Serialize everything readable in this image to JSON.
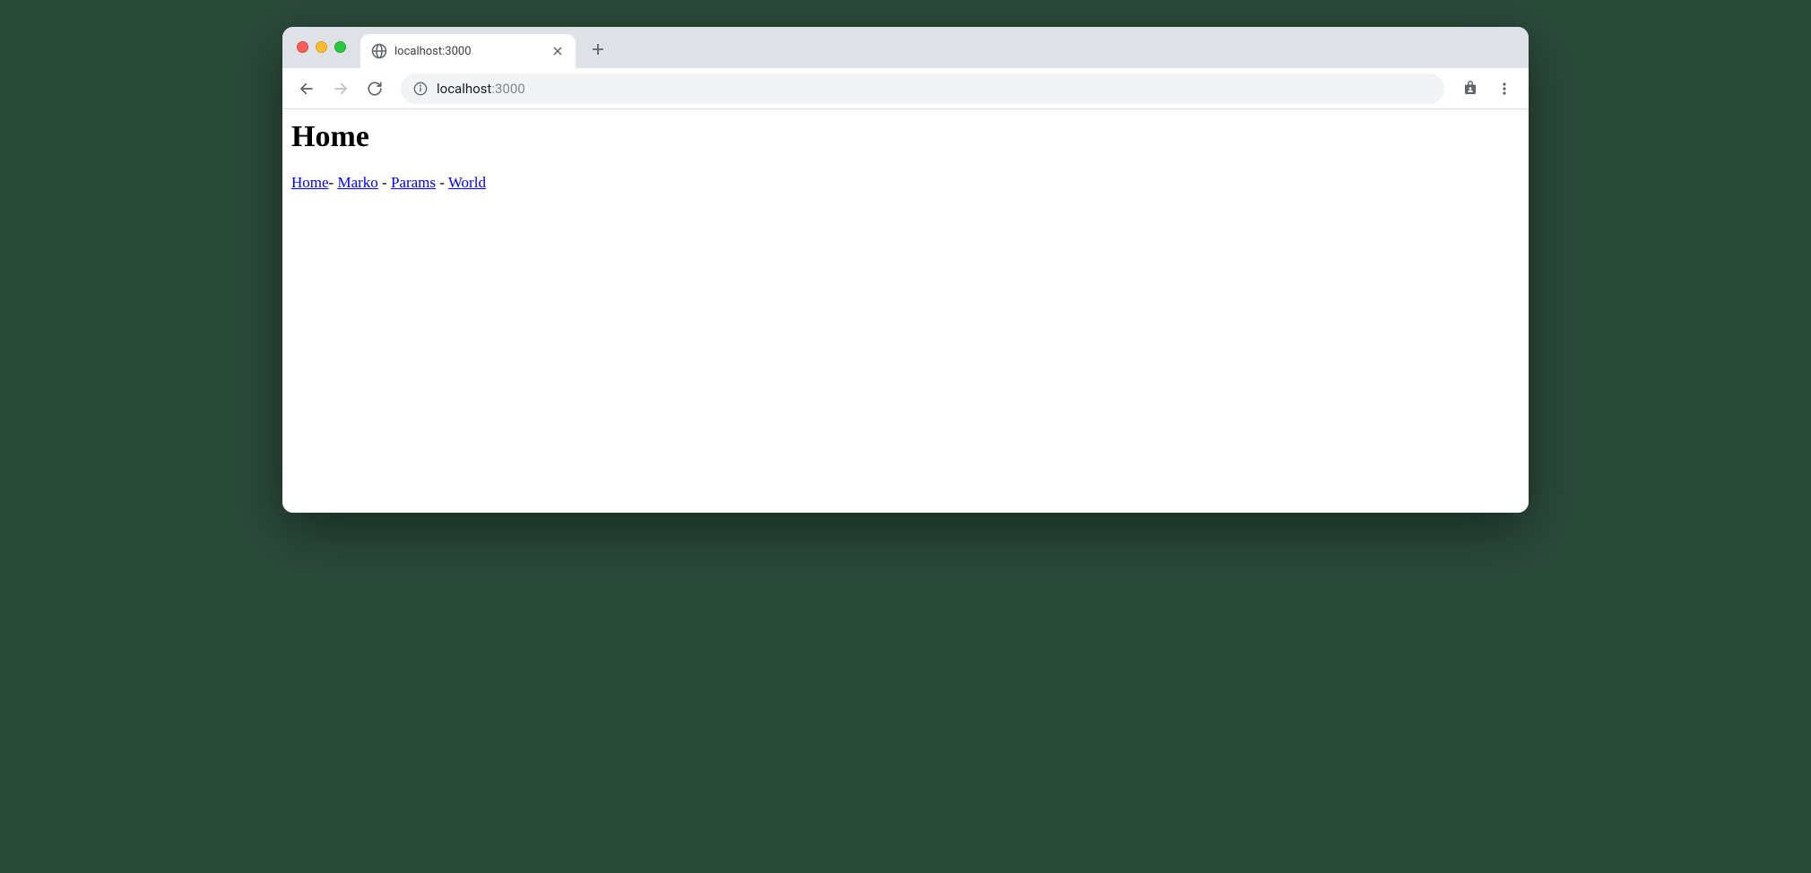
{
  "browser": {
    "tab": {
      "title": "localhost:3000"
    },
    "address": {
      "host": "localhost",
      "port": ":3000"
    }
  },
  "page": {
    "heading": "Home",
    "nav": {
      "links": [
        "Home",
        "Marko",
        "Params",
        "World"
      ],
      "sep0": "- ",
      "sep1": " - ",
      "sep2": " - "
    }
  }
}
